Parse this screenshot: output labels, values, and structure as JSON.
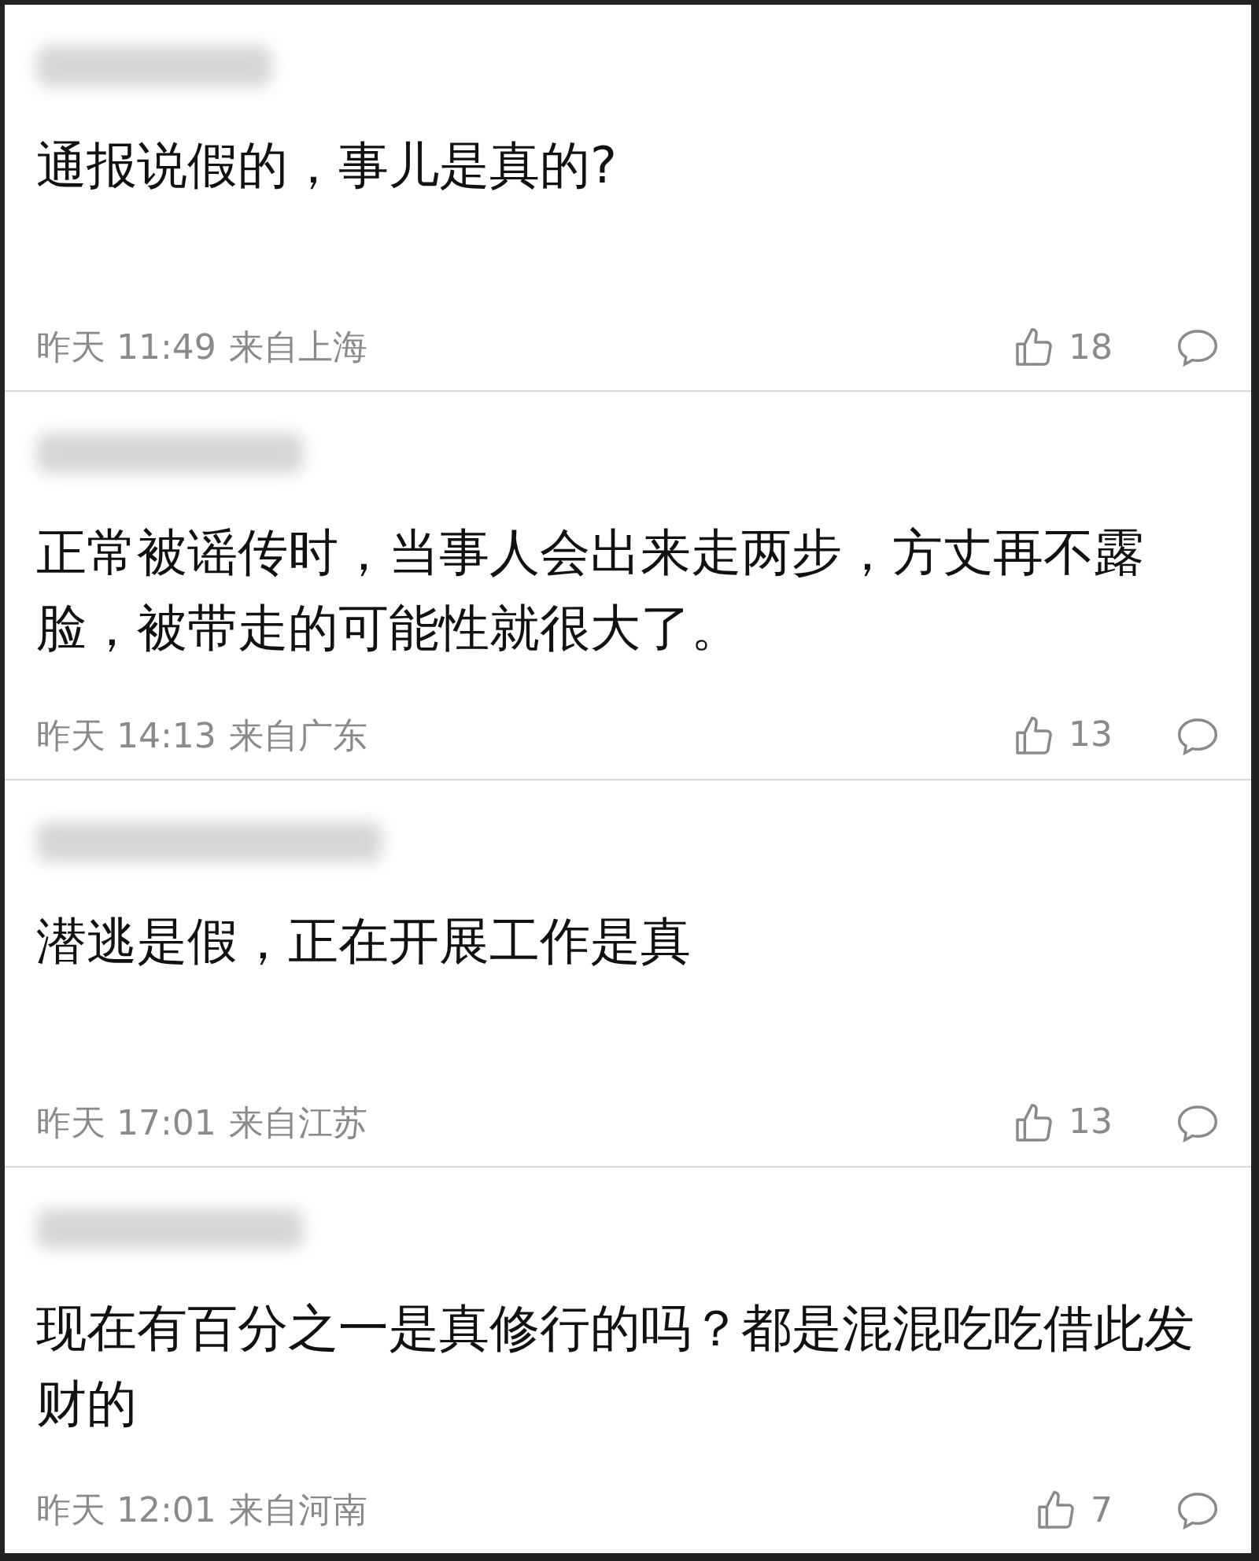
{
  "comments": [
    {
      "text": "通报说假的，事儿是真的?",
      "time": "昨天 11:49",
      "location": "来自上海",
      "likes": "18"
    },
    {
      "text": "正常被谣传时，当事人会出来走两步，方丈再不露脸，被带走的可能性就很大了。",
      "time": "昨天 14:13",
      "location": "来自广东",
      "likes": "13"
    },
    {
      "text": "潜逃是假，正在开展工作是真",
      "time": "昨天 17:01",
      "location": "来自江苏",
      "likes": "13"
    },
    {
      "text": "现在有百分之一是真修行的吗？都是混混吃吃借此发财的",
      "time": "昨天 12:01",
      "location": "来自河南",
      "likes": "7"
    }
  ]
}
